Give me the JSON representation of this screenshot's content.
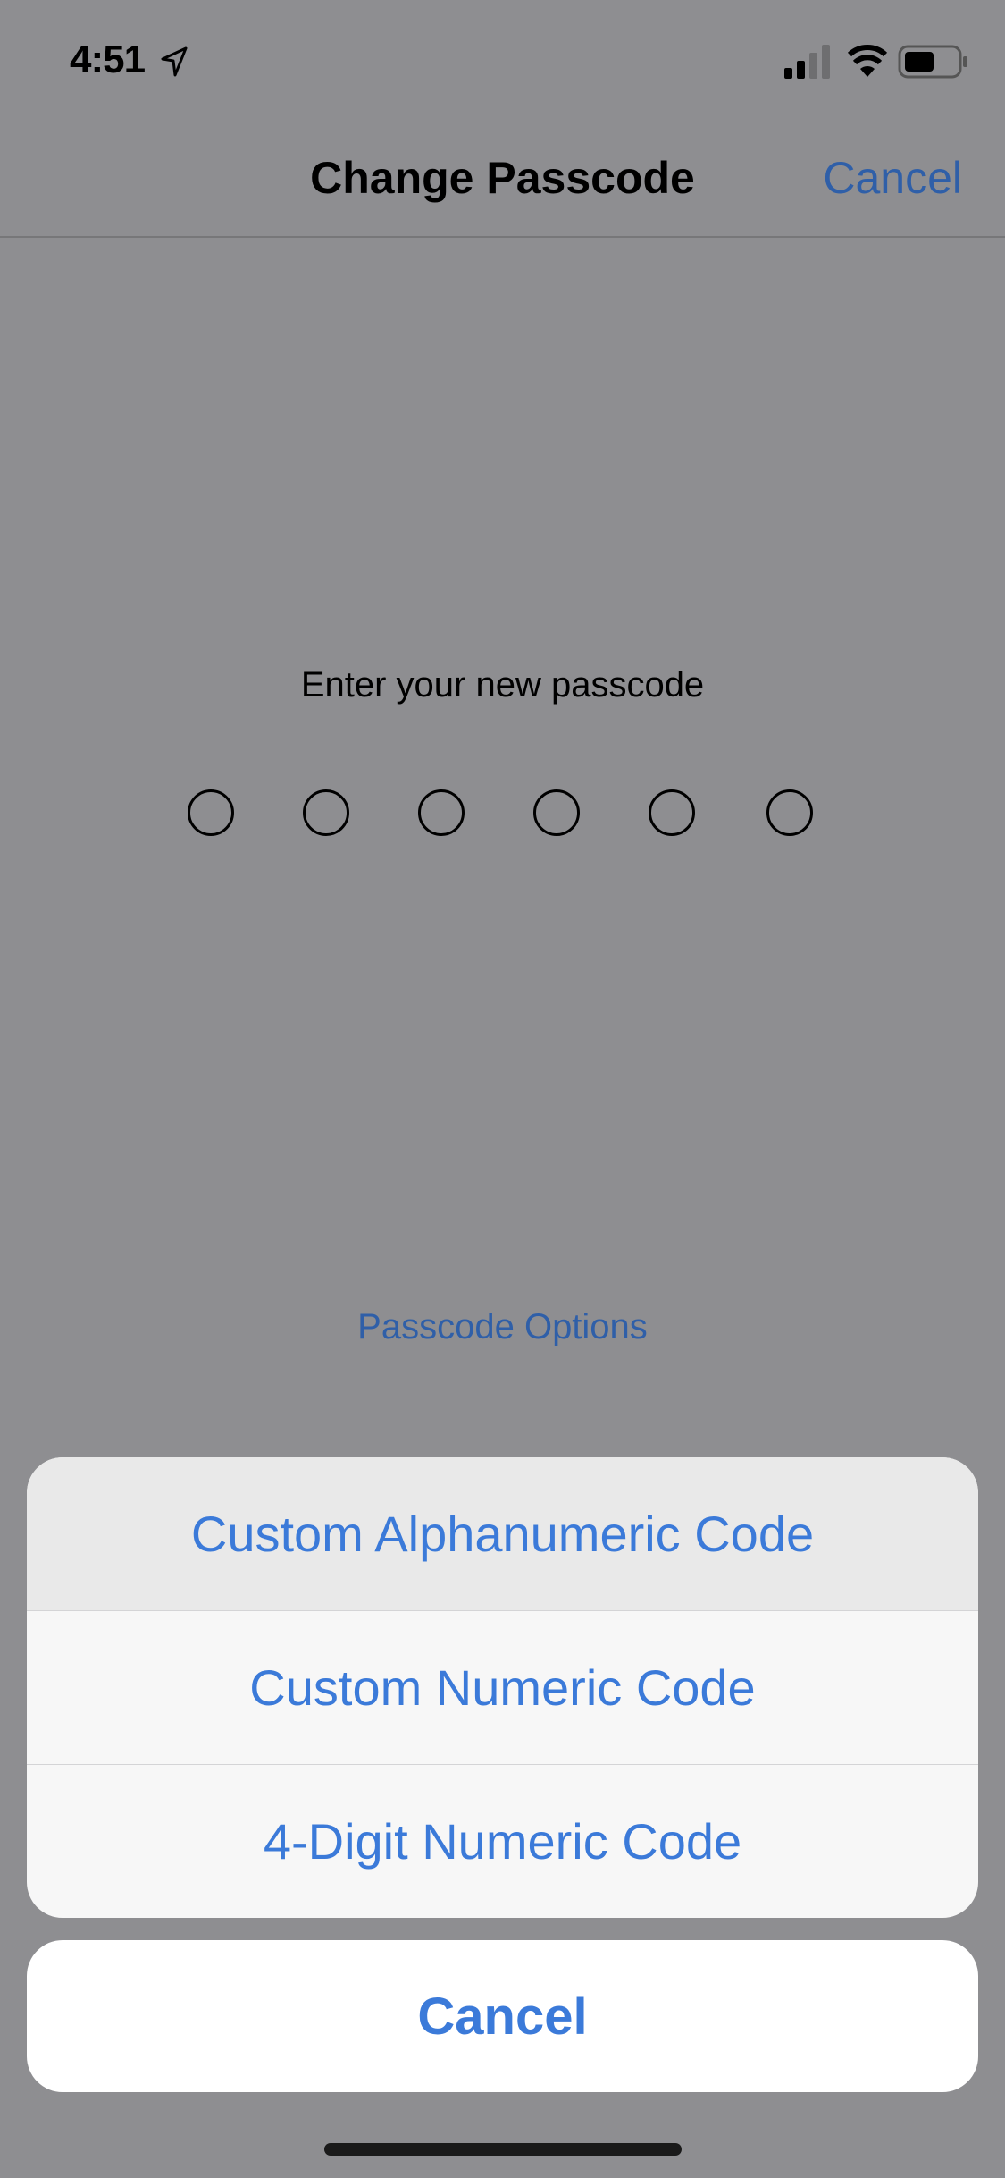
{
  "status_bar": {
    "time": "4:51",
    "icons": [
      "location-arrow-icon",
      "cellular-signal-icon",
      "wifi-icon",
      "battery-icon"
    ]
  },
  "nav": {
    "title": "Change Passcode",
    "cancel_label": "Cancel"
  },
  "passcode": {
    "prompt": "Enter your new passcode",
    "digit_count": 6,
    "digits_entered": 0
  },
  "options_link": "Passcode Options",
  "action_sheet": {
    "items": [
      {
        "label": "Custom Alphanumeric Code",
        "highlighted": true
      },
      {
        "label": "Custom Numeric Code",
        "highlighted": false
      },
      {
        "label": "4-Digit Numeric Code",
        "highlighted": false
      }
    ],
    "cancel_label": "Cancel"
  },
  "colors": {
    "accent": "#3b7ad9",
    "dimmed_accent": "#2f5fa8",
    "overlay_background": "#8e8e91"
  }
}
